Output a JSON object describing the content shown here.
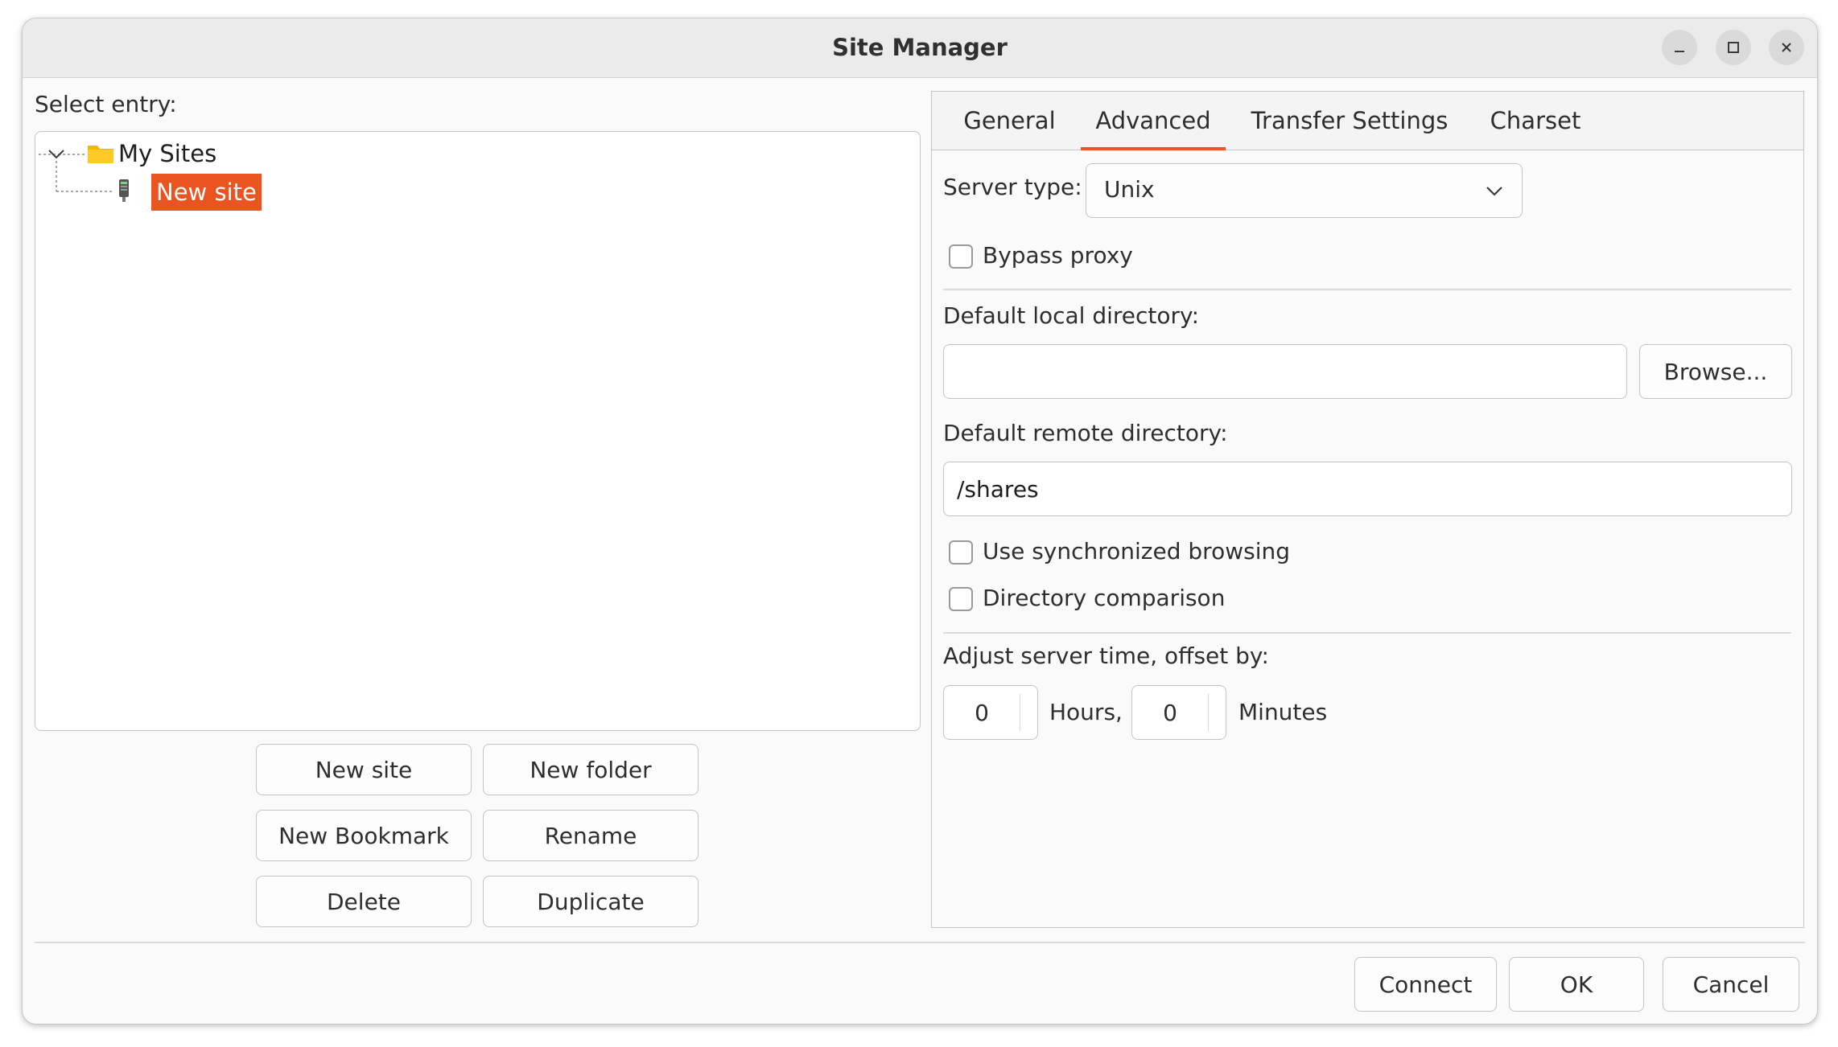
{
  "window": {
    "title": "Site Manager",
    "controls": {
      "minimize": "minimize-icon",
      "maximize": "maximize-icon",
      "close": "close-icon"
    }
  },
  "left": {
    "select_label": "Select entry:",
    "tree": {
      "root": {
        "label": "My Sites",
        "icon": "folder-icon",
        "expanded": true
      },
      "children": [
        {
          "label": "New site",
          "icon": "server-icon",
          "selected": true
        }
      ]
    },
    "buttons": {
      "new_site": "New site",
      "new_folder": "New folder",
      "new_bookmark": "New Bookmark",
      "rename": "Rename",
      "delete": "Delete",
      "duplicate": "Duplicate"
    }
  },
  "tabs": [
    {
      "label": "General",
      "active": false
    },
    {
      "label": "Advanced",
      "active": true
    },
    {
      "label": "Transfer Settings",
      "active": false
    },
    {
      "label": "Charset",
      "active": false
    }
  ],
  "advanced": {
    "server_type_label": "Server type:",
    "server_type_value": "Unix",
    "bypass_proxy": {
      "label": "Bypass proxy",
      "checked": false
    },
    "local_dir_label": "Default local directory:",
    "local_dir_value": "",
    "browse_label": "Browse...",
    "remote_dir_label": "Default remote directory:",
    "remote_dir_value": "/shares",
    "sync_browsing": {
      "label": "Use synchronized browsing",
      "checked": false
    },
    "dir_comparison": {
      "label": "Directory comparison",
      "checked": false
    },
    "time_offset_label": "Adjust server time, offset by:",
    "hours_value": "0",
    "hours_label": "Hours,",
    "minutes_value": "0",
    "minutes_label": "Minutes"
  },
  "footer": {
    "connect": "Connect",
    "ok": "OK",
    "cancel": "Cancel"
  },
  "colors": {
    "accent": "#e95420",
    "folder": "#f5b800"
  }
}
